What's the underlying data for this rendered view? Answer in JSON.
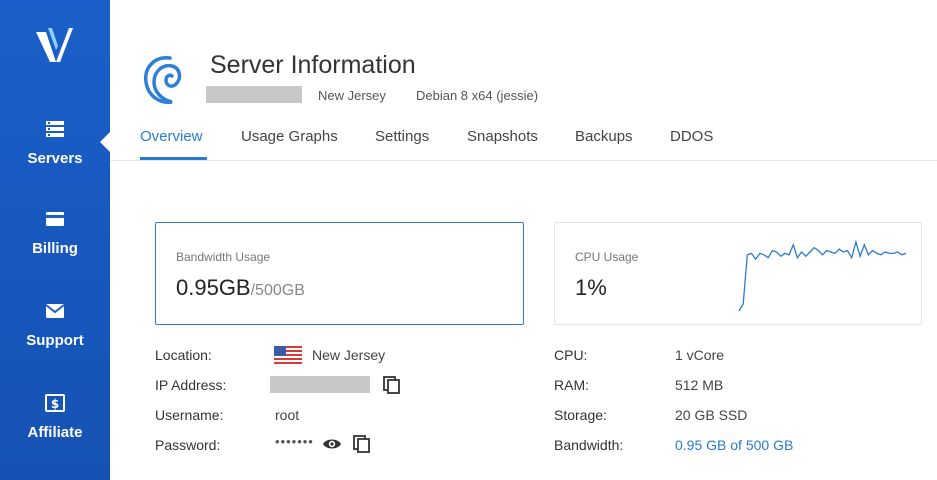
{
  "sidebar": {
    "items": [
      {
        "label": "Servers",
        "icon": "servers-icon"
      },
      {
        "label": "Billing",
        "icon": "credit-card-icon"
      },
      {
        "label": "Support",
        "icon": "envelope-icon"
      },
      {
        "label": "Affiliate",
        "icon": "dollar-icon"
      }
    ],
    "active": "Servers",
    "color": "#1a5fc9"
  },
  "header": {
    "title": "Server Information",
    "location": "New Jersey",
    "os": "Debian 8 x64 (jessie)"
  },
  "tabs": [
    {
      "label": "Overview",
      "active": true
    },
    {
      "label": "Usage Graphs"
    },
    {
      "label": "Settings"
    },
    {
      "label": "Snapshots"
    },
    {
      "label": "Backups"
    },
    {
      "label": "DDOS"
    }
  ],
  "bandwidth_card": {
    "label": "Bandwidth Usage",
    "value": "0.95GB",
    "limit": "/500GB"
  },
  "cpu_card": {
    "label": "CPU Usage",
    "value": "1%",
    "sparkline": [
      0,
      10,
      78,
      80,
      72,
      80,
      78,
      74,
      84,
      82,
      76,
      80,
      78,
      92,
      74,
      82,
      76,
      82,
      88,
      84,
      78,
      84,
      82,
      80,
      86,
      82,
      84,
      74,
      96,
      76,
      92,
      78,
      84,
      80,
      78,
      82,
      80,
      80,
      82,
      78,
      80
    ]
  },
  "details_left": [
    {
      "key": "Location:",
      "value": "New Jersey"
    },
    {
      "key": "IP Address:",
      "value": ""
    },
    {
      "key": "Username:",
      "value": "root"
    },
    {
      "key": "Password:",
      "value": "•••••••"
    }
  ],
  "details_right": [
    {
      "key": "CPU:",
      "value": "1 vCore"
    },
    {
      "key": "RAM:",
      "value": "512 MB"
    },
    {
      "key": "Storage:",
      "value": "20 GB SSD"
    },
    {
      "key": "Bandwidth:",
      "value": "0.95 GB of 500 GB"
    }
  ],
  "colors": {
    "accent": "#2a7bd3",
    "sidebar": "#1a5fc9"
  }
}
